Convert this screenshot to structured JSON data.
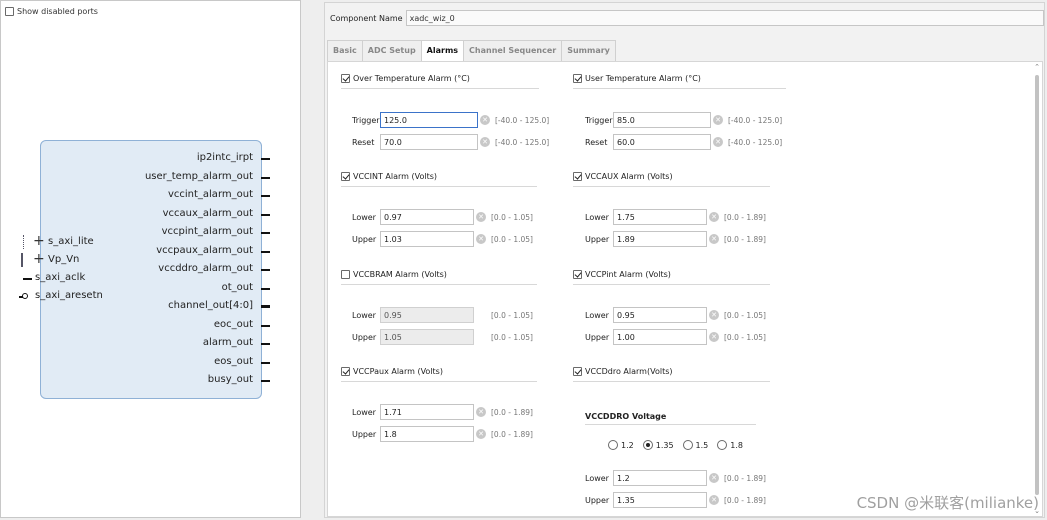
{
  "left_panel": {
    "show_disabled_ports": {
      "label": "Show disabled ports",
      "checked": false
    },
    "ports_right": [
      {
        "name": "ip2intc_irpt",
        "bus": false
      },
      {
        "name": "user_temp_alarm_out",
        "bus": false
      },
      {
        "name": "vccint_alarm_out",
        "bus": false
      },
      {
        "name": "vccaux_alarm_out",
        "bus": false
      },
      {
        "name": "vccpint_alarm_out",
        "bus": false
      },
      {
        "name": "vccpaux_alarm_out",
        "bus": false
      },
      {
        "name": "vccddro_alarm_out",
        "bus": false
      },
      {
        "name": "ot_out",
        "bus": false
      },
      {
        "name": "channel_out[4:0]",
        "bus": true
      },
      {
        "name": "eoc_out",
        "bus": false
      },
      {
        "name": "alarm_out",
        "bus": false
      },
      {
        "name": "eos_out",
        "bus": false
      },
      {
        "name": "busy_out",
        "bus": false
      }
    ],
    "ports_left": [
      {
        "name": "s_axi_lite",
        "kind": "interface"
      },
      {
        "name": "Vp_Vn",
        "kind": "bus-interface"
      },
      {
        "name": "s_axi_aclk",
        "kind": "input"
      },
      {
        "name": "s_axi_aresetn",
        "kind": "inverted-input"
      }
    ]
  },
  "component": {
    "label": "Component Name",
    "value": "xadc_wiz_0"
  },
  "tabs": [
    {
      "label": "Basic",
      "active": false
    },
    {
      "label": "ADC Setup",
      "active": false
    },
    {
      "label": "Alarms",
      "active": true
    },
    {
      "label": "Channel Sequencer",
      "active": false
    },
    {
      "label": "Summary",
      "active": false
    }
  ],
  "alarms": {
    "over_temp": {
      "label": "Over Temperature Alarm (°C)",
      "checked": true,
      "trigger": {
        "label": "Trigger",
        "value": "125.0",
        "range": "[-40.0 - 125.0]"
      },
      "reset": {
        "label": "Reset",
        "value": "70.0",
        "range": "[-40.0 - 125.0]"
      }
    },
    "user_temp": {
      "label": "User Temperature Alarm (°C)",
      "checked": true,
      "trigger": {
        "label": "Trigger",
        "value": "85.0",
        "range": "[-40.0 - 125.0]"
      },
      "reset": {
        "label": "Reset",
        "value": "60.0",
        "range": "[-40.0 - 125.0]"
      }
    },
    "vccint": {
      "label": "VCCINT Alarm (Volts)",
      "checked": true,
      "lower": {
        "label": "Lower",
        "value": "0.97",
        "range": "[0.0 - 1.05]"
      },
      "upper": {
        "label": "Upper",
        "value": "1.03",
        "range": "[0.0 - 1.05]"
      }
    },
    "vccaux": {
      "label": "VCCAUX Alarm (Volts)",
      "checked": true,
      "lower": {
        "label": "Lower",
        "value": "1.75",
        "range": "[0.0 - 1.89]"
      },
      "upper": {
        "label": "Upper",
        "value": "1.89",
        "range": "[0.0 - 1.89]"
      }
    },
    "vccbram": {
      "label": "VCCBRAM Alarm (Volts)",
      "checked": false,
      "lower": {
        "label": "Lower",
        "value": "0.95",
        "range": "[0.0 - 1.05]"
      },
      "upper": {
        "label": "Upper",
        "value": "1.05",
        "range": "[0.0 - 1.05]"
      }
    },
    "vccpint": {
      "label": "VCCPint Alarm (Volts)",
      "checked": true,
      "lower": {
        "label": "Lower",
        "value": "0.95",
        "range": "[0.0 - 1.05]"
      },
      "upper": {
        "label": "Upper",
        "value": "1.00",
        "range": "[0.0 - 1.05]"
      }
    },
    "vccpaux": {
      "label": "VCCPaux Alarm (Volts)",
      "checked": true,
      "lower": {
        "label": "Lower",
        "value": "1.71",
        "range": "[0.0 - 1.89]"
      },
      "upper": {
        "label": "Upper",
        "value": "1.8",
        "range": "[0.0 - 1.89]"
      }
    },
    "vccddro": {
      "label": "VCCDdro Alarm(Volts)",
      "checked": true,
      "voltage_title": "VCCDDRO Voltage",
      "voltage_options": [
        {
          "label": "1.2",
          "selected": false
        },
        {
          "label": "1.35",
          "selected": true
        },
        {
          "label": "1.5",
          "selected": false
        },
        {
          "label": "1.8",
          "selected": false
        }
      ],
      "lower": {
        "label": "Lower",
        "value": "1.2",
        "range": "[0.0 - 1.89]"
      },
      "upper": {
        "label": "Upper",
        "value": "1.35",
        "range": "[0.0 - 1.89]"
      }
    }
  },
  "watermark": "CSDN @米联客(milianke)"
}
